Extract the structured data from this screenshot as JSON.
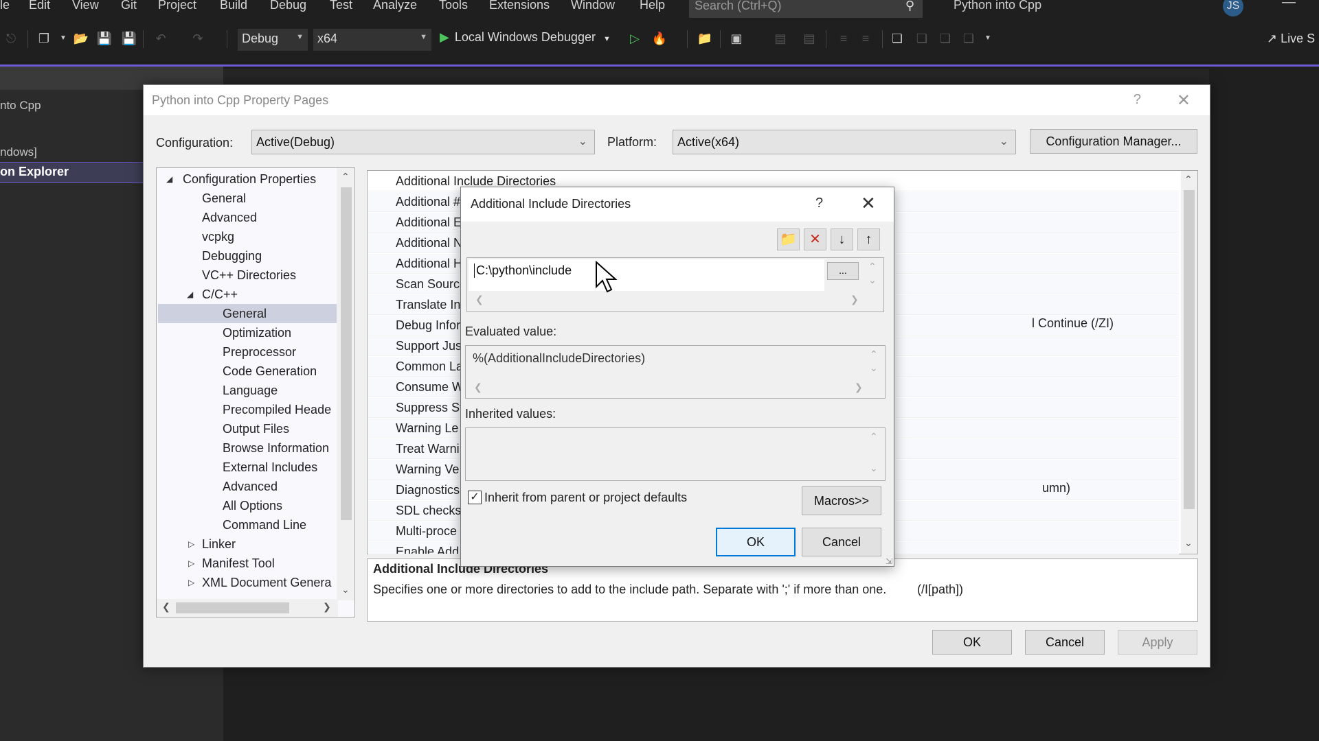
{
  "menubar": {
    "items": [
      "File",
      "Edit",
      "View",
      "Git",
      "Project",
      "Build",
      "Debug",
      "Test",
      "Analyze",
      "Tools",
      "Extensions",
      "Window",
      "Help"
    ],
    "visible_items": [
      "le",
      "Edit",
      "View",
      "Git",
      "Project",
      "Build",
      "Debug",
      "Test",
      "Analyze",
      "Tools",
      "Extensions",
      "Window",
      "Help"
    ],
    "search_placeholder": "Search (Ctrl+Q)",
    "app_title": "Python into Cpp",
    "avatar_initials": "JS"
  },
  "toolbar": {
    "configuration": "Debug",
    "platform": "x64",
    "run_label": "Local Windows Debugger",
    "live_share": "Live S"
  },
  "left_panel": {
    "project_name": "nto Cpp",
    "windows_label": "ndows]",
    "solution_explorer_tab": "on Explorer"
  },
  "property_pages": {
    "title": "Python into Cpp Property Pages",
    "help": "?",
    "close": "✕",
    "configuration_label": "Configuration:",
    "configuration_value": "Active(Debug)",
    "platform_label": "Platform:",
    "platform_value": "Active(x64)",
    "config_manager_button": "Configuration Manager...",
    "tree": [
      {
        "label": "Configuration Properties",
        "level": 0,
        "expanded": true
      },
      {
        "label": "General",
        "level": 1
      },
      {
        "label": "Advanced",
        "level": 1
      },
      {
        "label": "vcpkg",
        "level": 1
      },
      {
        "label": "Debugging",
        "level": 1
      },
      {
        "label": "VC++ Directories",
        "level": 1
      },
      {
        "label": "C/C++",
        "level": 1,
        "expanded": true
      },
      {
        "label": "General",
        "level": 2,
        "selected": true
      },
      {
        "label": "Optimization",
        "level": 2
      },
      {
        "label": "Preprocessor",
        "level": 2
      },
      {
        "label": "Code Generation",
        "level": 2
      },
      {
        "label": "Language",
        "level": 2
      },
      {
        "label": "Precompiled Heade",
        "level": 2
      },
      {
        "label": "Output Files",
        "level": 2
      },
      {
        "label": "Browse Information",
        "level": 2
      },
      {
        "label": "External Includes",
        "level": 2
      },
      {
        "label": "Advanced",
        "level": 2
      },
      {
        "label": "All Options",
        "level": 2
      },
      {
        "label": "Command Line",
        "level": 2
      },
      {
        "label": "Linker",
        "level": 1,
        "collapsed": true
      },
      {
        "label": "Manifest Tool",
        "level": 1,
        "collapsed": true
      },
      {
        "label": "XML Document Genera",
        "level": 1,
        "collapsed": true
      }
    ],
    "grid_rows": [
      "Additional Include Directories",
      "Additional #",
      "Additional E",
      "Additional N",
      "Additional H",
      "Scan Source",
      "Translate In",
      "Debug Infor",
      "Support Jus",
      "Common La",
      "Consume W",
      "Suppress St",
      "Warning Le",
      "Treat Warni",
      "Warning Ve",
      "Diagnostics",
      "SDL checks",
      "Multi-proce",
      "Enable Add"
    ],
    "grid_values": {
      "debug_info_tail": "l Continue (/ZI)",
      "diagnostics_tail": "umn)"
    },
    "description_title": "Additional Include Directories",
    "description_text": "Specifies one or more directories to add to the include path. Separate with ';' if more than one.",
    "description_switch": "(/I[path])",
    "ok_button": "OK",
    "cancel_button": "Cancel",
    "apply_button": "Apply"
  },
  "include_dialog": {
    "title": "Additional Include Directories",
    "help": "?",
    "close": "✕",
    "entries": [
      "C:\\python\\include"
    ],
    "browse_button": "...",
    "evaluated_label": "Evaluated value:",
    "evaluated_value": "%(AdditionalIncludeDirectories)",
    "inherited_label": "Inherited values:",
    "inherited_value": "",
    "inherit_checkbox_label": "Inherit from parent or project defaults",
    "inherit_checked": true,
    "macros_button": "Macros>>",
    "ok_button": "OK",
    "cancel_button": "Cancel"
  },
  "colors": {
    "accent": "#6c5cd6",
    "run_green": "#4cc35c",
    "delete_red": "#c42b1c",
    "focus_blue": "#0078d7"
  }
}
